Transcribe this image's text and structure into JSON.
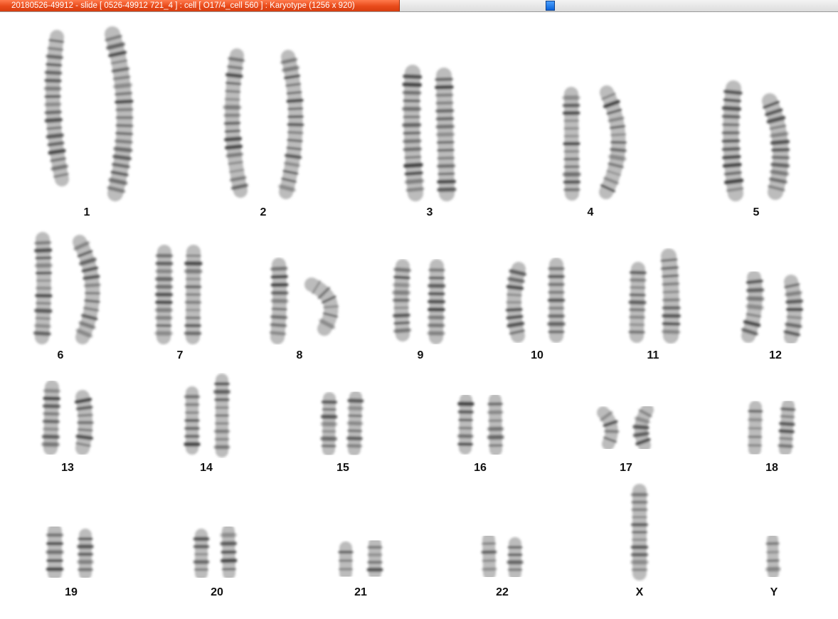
{
  "window": {
    "title": "20180526-49912 - slide [ 0526-49912 721_4 ] : cell [ O17/4_cell 560 ] : Karyotype  (1256 x 920)"
  },
  "karyotype": {
    "chromosomes": [
      {
        "id": "chr-1",
        "label": "1"
      },
      {
        "id": "chr-2",
        "label": "2"
      },
      {
        "id": "chr-3",
        "label": "3"
      },
      {
        "id": "chr-4",
        "label": "4"
      },
      {
        "id": "chr-5",
        "label": "5"
      },
      {
        "id": "chr-6",
        "label": "6"
      },
      {
        "id": "chr-7",
        "label": "7"
      },
      {
        "id": "chr-8",
        "label": "8"
      },
      {
        "id": "chr-9",
        "label": "9"
      },
      {
        "id": "chr-10",
        "label": "10"
      },
      {
        "id": "chr-11",
        "label": "11"
      },
      {
        "id": "chr-12",
        "label": "12"
      },
      {
        "id": "chr-13",
        "label": "13"
      },
      {
        "id": "chr-14",
        "label": "14"
      },
      {
        "id": "chr-15",
        "label": "15"
      },
      {
        "id": "chr-16",
        "label": "16"
      },
      {
        "id": "chr-17",
        "label": "17"
      },
      {
        "id": "chr-18",
        "label": "18"
      },
      {
        "id": "chr-19",
        "label": "19"
      },
      {
        "id": "chr-20",
        "label": "20"
      },
      {
        "id": "chr-21",
        "label": "21"
      },
      {
        "id": "chr-22",
        "label": "22"
      },
      {
        "id": "chr-x",
        "label": "X"
      },
      {
        "id": "chr-y",
        "label": "Y"
      }
    ],
    "colors": {
      "chromosome_dark": "#3a3a3a",
      "chromosome_light": "#bcbcbc",
      "title_bar": "#e84a1a",
      "splitter_handle": "#0b63d9"
    }
  }
}
